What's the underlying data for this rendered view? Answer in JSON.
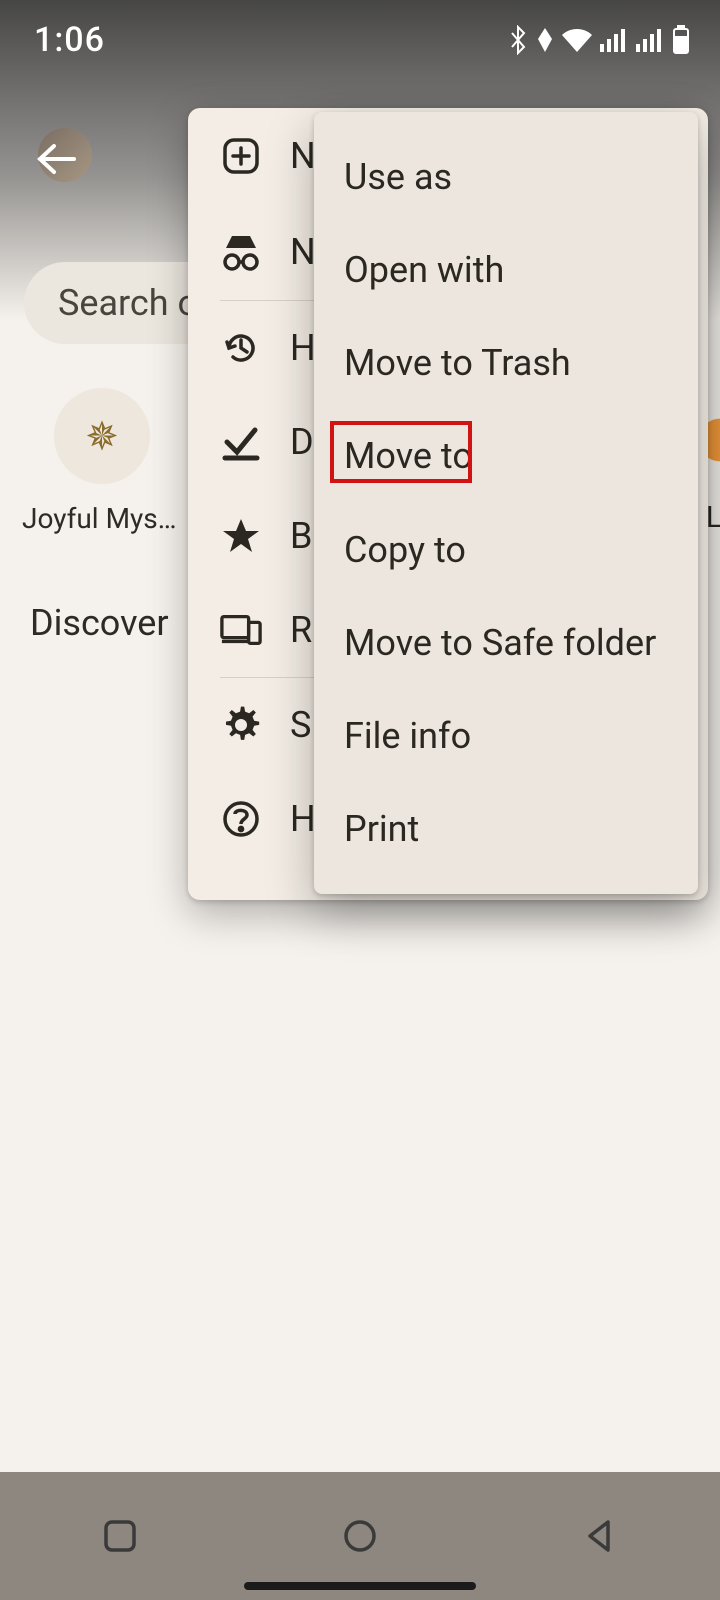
{
  "status": {
    "time": "1:06"
  },
  "search": {
    "placeholder": "Search or"
  },
  "tile": {
    "label": "Joyful Myst…"
  },
  "discover": {
    "label": "Discover"
  },
  "side_menu": {
    "items": [
      {
        "label": "N"
      },
      {
        "label": "N"
      },
      {
        "label": "H"
      },
      {
        "label": "D"
      },
      {
        "label": "B"
      },
      {
        "label": "R"
      },
      {
        "label": "S"
      },
      {
        "label": "H"
      }
    ]
  },
  "context_menu": {
    "items": [
      "Use as",
      "Open with",
      "Move to Trash",
      "Move to",
      "Copy to",
      "Move to Safe folder",
      "File info",
      "Print"
    ],
    "highlighted_index": 3
  },
  "peek": {
    "letter": "L"
  }
}
